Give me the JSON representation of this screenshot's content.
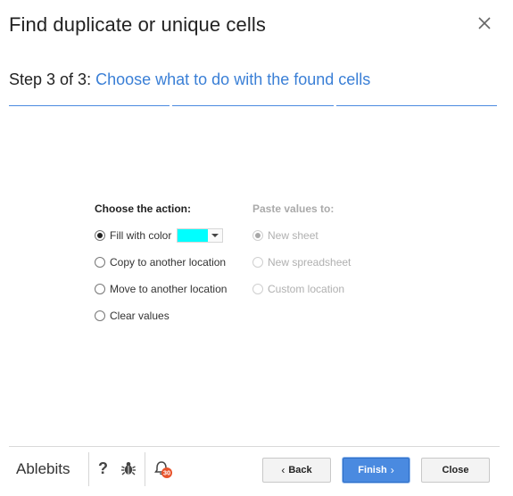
{
  "dialog": {
    "title": "Find duplicate or unique cells"
  },
  "step": {
    "prefix": "Step 3 of 3:",
    "name": "Choose what to do with the found cells"
  },
  "actions": {
    "heading": "Choose the action:",
    "options": [
      {
        "label": "Fill with color",
        "checked": true
      },
      {
        "label": "Copy to another location",
        "checked": false
      },
      {
        "label": "Move to another location",
        "checked": false
      },
      {
        "label": "Clear values",
        "checked": false
      }
    ],
    "fill_color": "#00ffff"
  },
  "paste": {
    "heading": "Paste values to:",
    "options": [
      {
        "label": "New sheet",
        "checked": true
      },
      {
        "label": "New spreadsheet",
        "checked": false
      },
      {
        "label": "Custom location",
        "checked": false
      }
    ]
  },
  "footer": {
    "brand": "Ablebits",
    "help_label": "?",
    "notification_count": "30",
    "back_label": "Back",
    "finish_label": "Finish",
    "close_label": "Close"
  },
  "colors": {
    "accent": "#3a7fd6",
    "primary_button": "#4a8ae0",
    "badge": "#e8532b"
  }
}
